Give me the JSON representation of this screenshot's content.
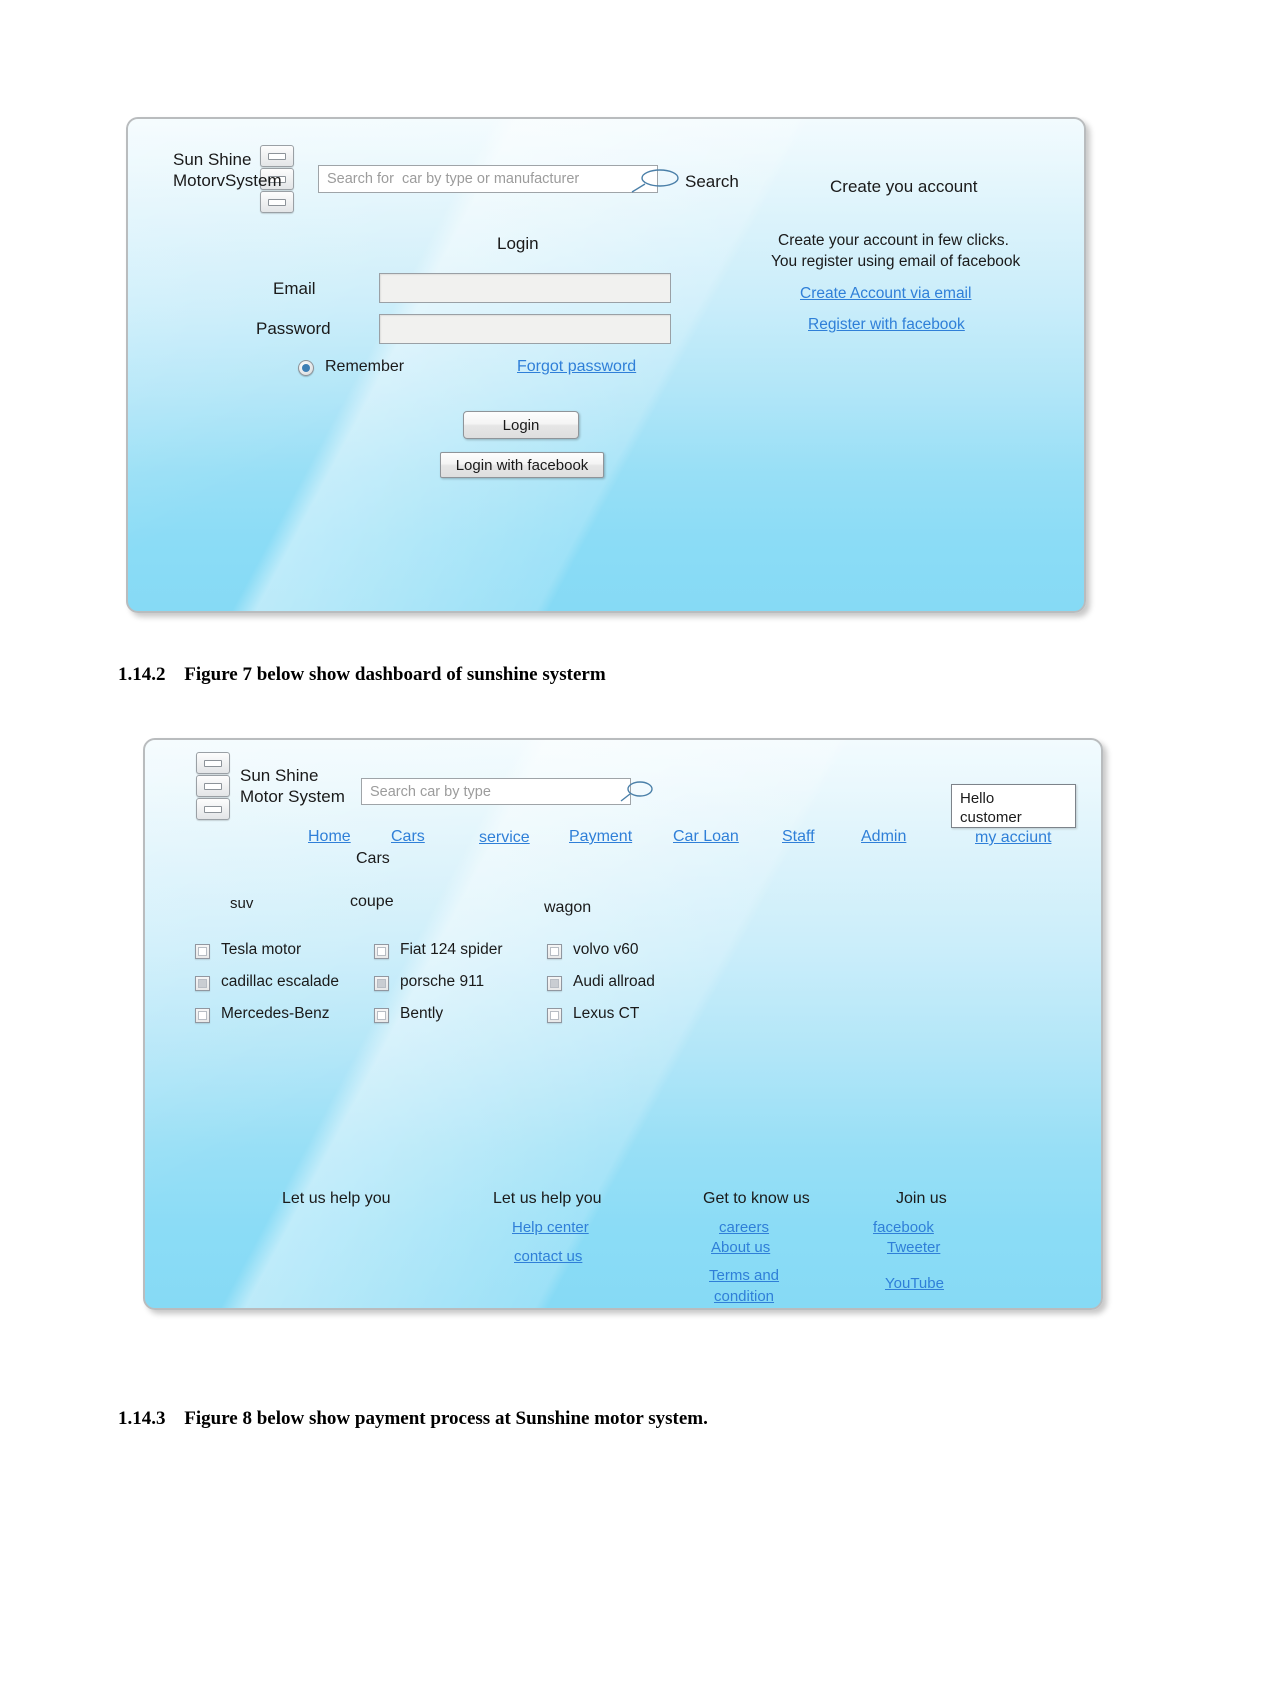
{
  "document": {
    "captions": [
      {
        "number": "1.14.2",
        "text": "Figure 7 below show dashboard of sunshine systerm"
      },
      {
        "number": "1.14.3",
        "text": "Figure 8 below show payment process at Sunshine motor system."
      }
    ]
  },
  "colors": {
    "link": "#2f7fd8",
    "panel_top": "#f2fbfe",
    "panel_bottom": "#86daf5",
    "radio_dot": "#3d7fb5"
  },
  "figure_login": {
    "brand": "Sun Shine\nMotorvSystem",
    "search": {
      "placeholder": "Search for  car by type or manufacturer",
      "value": "",
      "icon": "magnifier-icon",
      "button_label": "Search"
    },
    "form": {
      "title": "Login",
      "email_label": "Email",
      "email_value": "",
      "password_label": "Password",
      "password_value": "",
      "remember_label": "Remember",
      "remember_checked": true,
      "forgot_link": "Forgot password",
      "login_button": "Login",
      "facebook_button": "Login with facebook"
    },
    "register": {
      "heading": "Create you  account",
      "blurb_line1": "Create your account in few clicks.",
      "blurb_line2": "You register using email of facebook",
      "links": [
        "Create Account via email",
        "Register with facebook"
      ]
    }
  },
  "figure_dashboard": {
    "brand": "Sun Shine\nMotor System",
    "search": {
      "placeholder": "Search car by type",
      "value": "",
      "icon": "magnifier-icon"
    },
    "greeting": "Hello\ncustomer",
    "nav": [
      "Home",
      "Cars",
      "service",
      "Payment",
      "Car Loan",
      "Staff",
      "Admin",
      "my acciunt"
    ],
    "section_title": "Cars",
    "categories": [
      {
        "name": "suv",
        "items": [
          {
            "label": "Tesla motor",
            "checked": false
          },
          {
            "label": "cadillac escalade",
            "checked": true
          },
          {
            "label": "Mercedes-Benz",
            "checked": false
          }
        ]
      },
      {
        "name": "coupe",
        "items": [
          {
            "label": "Fiat 124 spider",
            "checked": false
          },
          {
            "label": "porsche 911",
            "checked": true
          },
          {
            "label": "Bently",
            "checked": false
          }
        ]
      },
      {
        "name": "wagon",
        "items": [
          {
            "label": "volvo v60",
            "checked": false
          },
          {
            "label": "Audi allroad",
            "checked": true
          },
          {
            "label": "Lexus CT",
            "checked": false
          }
        ]
      }
    ],
    "footer": [
      {
        "heading": "Let us help you",
        "links": []
      },
      {
        "heading": "Let us help you",
        "links": [
          "Help center",
          "contact us"
        ]
      },
      {
        "heading": "Get to know us",
        "links": [
          "careers",
          "About us",
          "Terms and\ncondition"
        ]
      },
      {
        "heading": "Join us",
        "links": [
          "facebook",
          "Tweeter",
          "YouTube"
        ]
      }
    ]
  }
}
